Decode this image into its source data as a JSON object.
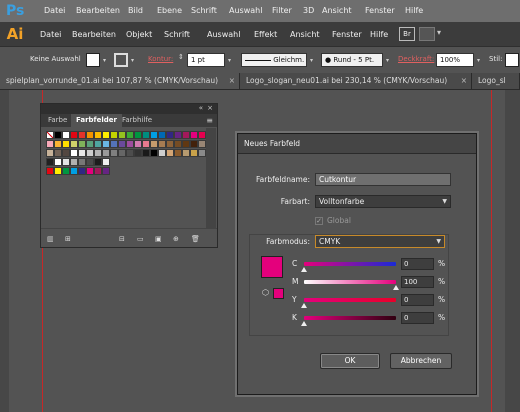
{
  "photoshop": {
    "logo": "Ps",
    "menu": [
      "Datei",
      "Bearbeiten",
      "Bild",
      "Ebene",
      "Schrift",
      "Auswahl",
      "Filter",
      "3D",
      "Ansicht",
      "Fenster",
      "Hilfe"
    ]
  },
  "illustrator": {
    "logo": "Ai",
    "menu": [
      "Datei",
      "Bearbeiten",
      "Objekt",
      "Schrift",
      "Auswahl",
      "Effekt",
      "Ansicht",
      "Fenster",
      "Hilfe"
    ],
    "bridge_label": "Br"
  },
  "control_bar": {
    "selection": "Keine Auswahl",
    "kontur_label": "Kontur:",
    "kontur_value": "1 pt",
    "stroke_profile": "Gleichm.",
    "brush": "Rund - 5 Pt.",
    "deckkraft_label": "Deckkraft:",
    "deckkraft_value": "100%",
    "stil_label": "Stil:"
  },
  "tabs": [
    {
      "label": "spielplan_vorrunde_01.ai bei 107,87 % (CMYK/Vorschau)"
    },
    {
      "label": "Logo_slogan_neu01.ai bei 230,14 % (CMYK/Vorschau)"
    },
    {
      "label": "Logo_sl"
    }
  ],
  "swatch_panel": {
    "tabs": [
      "Farbe",
      "Farbfelder",
      "Farbhilfe"
    ],
    "active_tab": "Farbfelder",
    "rows": [
      [
        "#ffffff",
        "#000000",
        "#ffffff",
        "#e30613",
        "#e5332a",
        "#f39200",
        "#fbba00",
        "#ffed00",
        "#c5d300",
        "#95c11f",
        "#3aaa35",
        "#009640",
        "#008d7f",
        "#009fe3",
        "#0069b4",
        "#312783",
        "#662483",
        "#a3195b",
        "#e6007e",
        "#e5004f"
      ],
      [
        "#f7a8b8",
        "#f9b233",
        "#ffde00",
        "#d1d36a",
        "#80b25a",
        "#5aa07a",
        "#4ea5a0",
        "#6ab7e4",
        "#5473b8",
        "#6a4a9b",
        "#9e4d9e",
        "#d37bb0",
        "#e87a8e",
        "#c69c6d",
        "#a67c52",
        "#8c6239",
        "#754c24",
        "#603813",
        "#42210b",
        "#998675"
      ],
      [
        "#c7b299",
        "#736357",
        "#534741",
        "#ffffff",
        "#e6e6e6",
        "#cccccc",
        "#b3b3b3",
        "#999999",
        "#808080",
        "#666666",
        "#4d4d4d",
        "#333333",
        "#1a1a1a",
        "#000000",
        "#cfcfcf",
        "#d4a574",
        "#8a5a2b",
        "#b69a6f",
        "#c9a24a",
        "#8a8a8a"
      ],
      [
        "#222222",
        "#ffffff",
        "#e3e3e3",
        "#b0b0b0",
        "#777777",
        "#4a4a4a",
        "#1d1d1d",
        "#f0f0f0"
      ],
      [
        "#e30613",
        "#ffed00",
        "#009640",
        "#009fe3",
        "#312783",
        "#e6007e",
        "#a3195b",
        "#662483"
      ]
    ]
  },
  "dialog": {
    "title": "Neues Farbfeld",
    "name_label": "Farbfeldname:",
    "name_value": "Cutkontur",
    "type_label": "Farbart:",
    "type_value": "Volltonfarbe",
    "global_label": "Global",
    "mode_label": "Farbmodus:",
    "mode_value": "CMYK",
    "preview_color": "#e4007c",
    "channels": [
      {
        "label": "C",
        "value": "0",
        "unit": "%",
        "level": 0,
        "color": "#e4007c"
      },
      {
        "label": "M",
        "value": "100",
        "unit": "%",
        "level": 1,
        "color": "#e4007c"
      },
      {
        "label": "Y",
        "value": "0",
        "unit": "%",
        "level": 0,
        "color": "#e4007c"
      },
      {
        "label": "K",
        "value": "0",
        "unit": "%",
        "level": 0,
        "color": "#e4007c"
      }
    ],
    "ok_label": "OK",
    "cancel_label": "Abbrechen"
  }
}
